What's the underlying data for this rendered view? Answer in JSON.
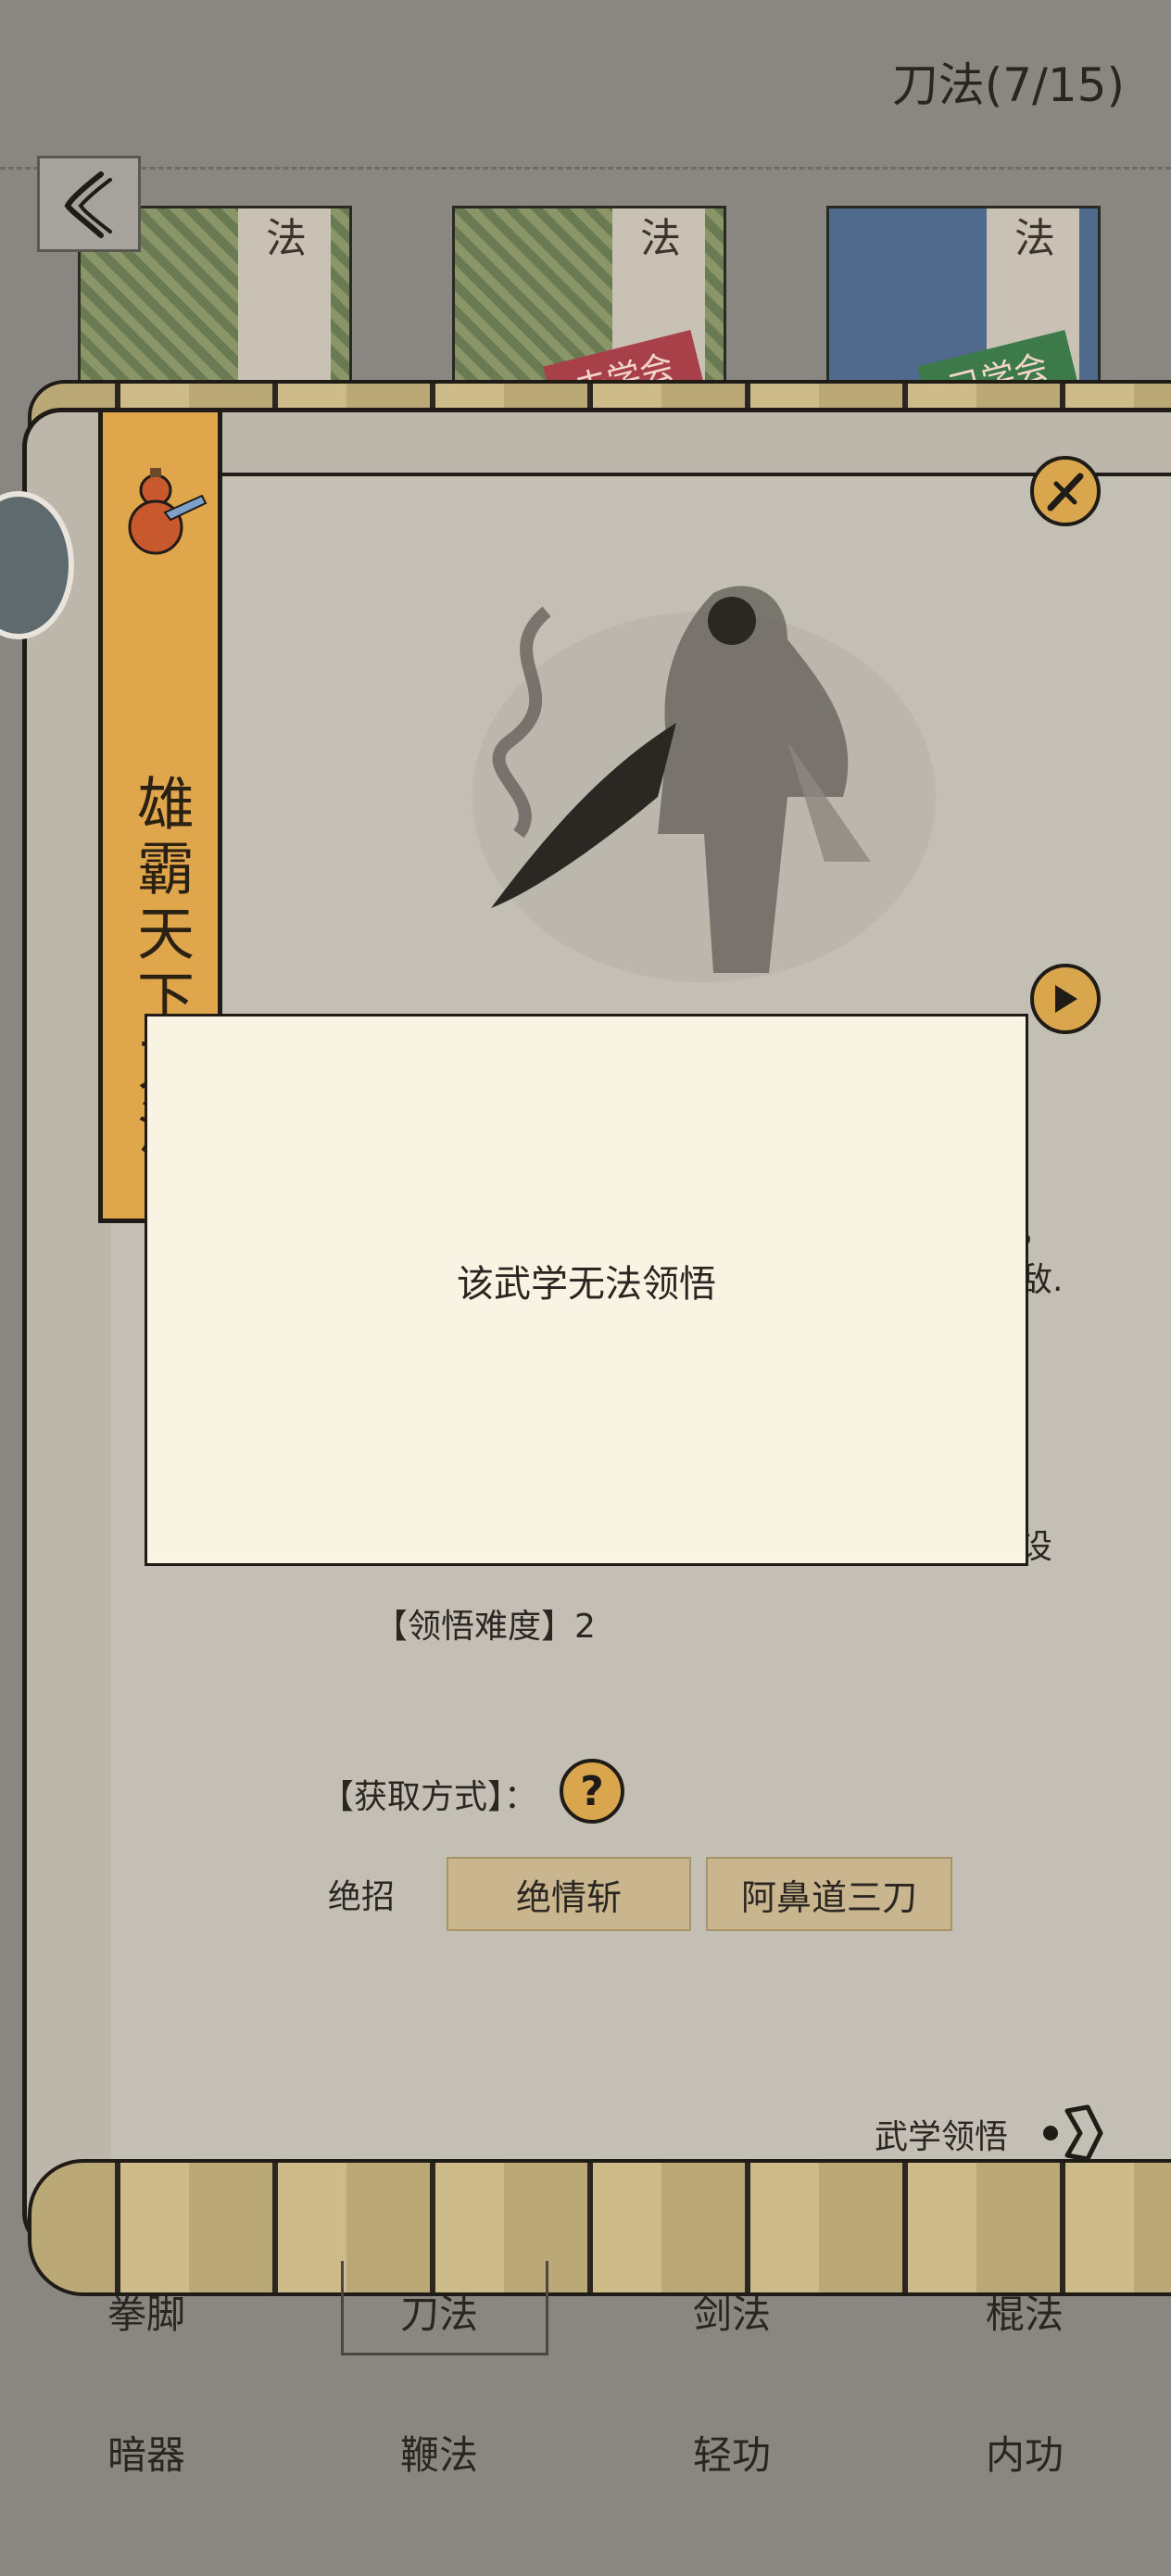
{
  "header": {
    "title": "刀法(7/15)"
  },
  "book_shelf": {
    "spine_labels": [
      "法",
      "法",
      "法"
    ],
    "tags": [
      "未学会",
      "已学会"
    ]
  },
  "skill": {
    "name": "雄霸天下刀法",
    "partial_text_1": "，",
    "partial_text_2": "敌.",
    "partial_text_3": "设",
    "difficulty_label": "【领悟难度】",
    "difficulty_value": "2",
    "acquire_label": "【获取方式】：",
    "moves_label": "绝招",
    "moves": [
      "绝情斩",
      "阿鼻道三刀"
    ],
    "comprehend_link": "武学领悟"
  },
  "modal": {
    "message": "该武学无法领悟"
  },
  "bottom_nav": {
    "row1": [
      "拳脚",
      "刀法",
      "剑法",
      "棍法"
    ],
    "row2": [
      "暗器",
      "鞭法",
      "轻功",
      "内功"
    ],
    "selected": "刀法"
  },
  "colors": {
    "accent": "#d9a64e",
    "paper": "#c4bfb5",
    "modal_bg": "#f9f3e3",
    "background": "#8a8782"
  },
  "icons": [
    "back-arrow-icon",
    "close-icon",
    "play-icon",
    "gourd-icon",
    "question-icon",
    "comprehend-arrow-icon",
    "side-badge-icon"
  ]
}
